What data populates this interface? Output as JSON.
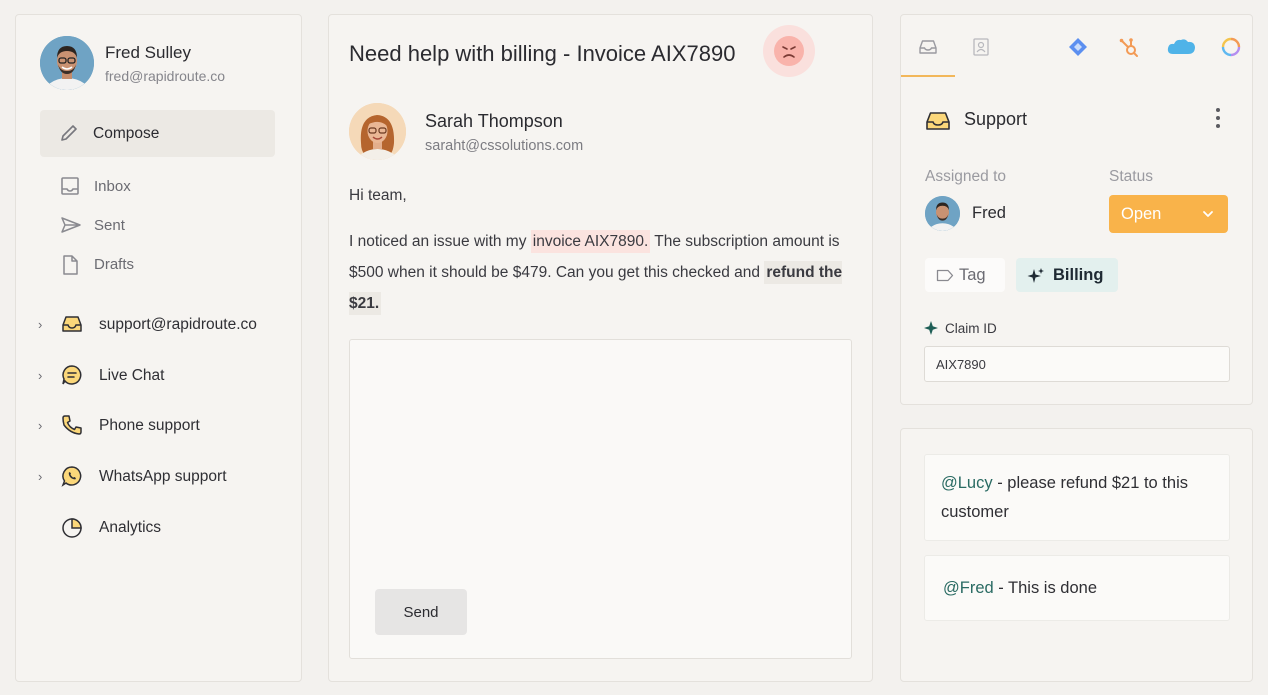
{
  "user": {
    "name": "Fred Sulley",
    "email": "fred@rapidroute.co"
  },
  "sidebar": {
    "compose_label": "Compose",
    "mail_items": [
      {
        "label": "Inbox",
        "icon": "inbox-icon"
      },
      {
        "label": "Sent",
        "icon": "send-icon"
      },
      {
        "label": "Drafts",
        "icon": "document-icon"
      }
    ],
    "channels": [
      {
        "label": "support@rapidroute.co",
        "icon": "inbox-tray-icon",
        "expandable": true
      },
      {
        "label": "Live Chat",
        "icon": "chat-bubble-icon",
        "expandable": true
      },
      {
        "label": "Phone support",
        "icon": "phone-icon",
        "expandable": true
      },
      {
        "label": "WhatsApp support",
        "icon": "whatsapp-icon",
        "expandable": true
      },
      {
        "label": "Analytics",
        "icon": "pie-chart-icon",
        "expandable": false
      }
    ]
  },
  "ticket": {
    "subject": "Need help with billing - Invoice AIX7890",
    "sentiment_icon": "angry-face-icon",
    "sender": {
      "name": "Sarah Thompson",
      "email": "saraht@cssolutions.com"
    },
    "greeting": "Hi team,",
    "body": {
      "part1": "I noticed an issue with my ",
      "highlight_invoice": "invoice AIX7890.",
      "part2": " The subscription amount is $500 when it should be $479. Can you get this checked and ",
      "highlight_refund": "refund the $21."
    },
    "reply": {
      "send_label": "Send"
    }
  },
  "details": {
    "app_tabs": [
      "inbox-tray-icon",
      "contact-card-icon",
      "jira-icon",
      "hubspot-icon",
      "salesforce-icon",
      "sync-icon"
    ],
    "queue_label": "Support",
    "assigned_label": "Assigned to",
    "assignee": "Fred",
    "status_label": "Status",
    "status_value": "Open",
    "tag_label": "Tag",
    "billing_tag": "Billing",
    "claim_label": "Claim ID",
    "claim_value": "AIX7890"
  },
  "notes": [
    {
      "mention": "@Lucy",
      "text": " - please refund $21 to this customer"
    },
    {
      "mention": "@Fred",
      "text": " - This is done"
    }
  ],
  "colors": {
    "accent_orange": "#f9b34a",
    "mention_teal": "#2a6b63",
    "billing_tag_bg": "#e3f0ee"
  }
}
